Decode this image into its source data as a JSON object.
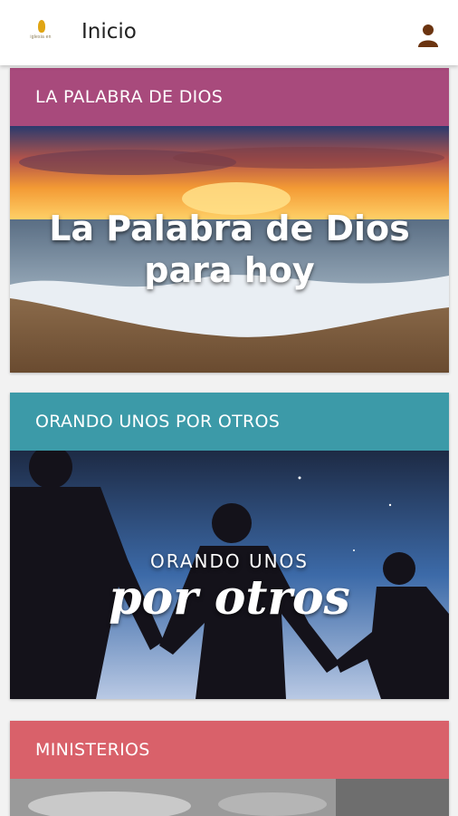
{
  "appbar": {
    "logo_icon": "church-logo",
    "logo_text": "iglesia en",
    "title": "Inicio",
    "profile_icon": "user-profile-icon"
  },
  "cards": [
    {
      "header": "LA PALABRA DE DIOS",
      "header_color": "#a84a7c",
      "image_title_line1": "La Palabra de Dios",
      "image_title_line2": "para hoy"
    },
    {
      "header": "ORANDO UNOS POR OTROS",
      "header_color": "#3c9aa8",
      "image_title_line1": "ORANDO UNOS",
      "image_title_line2": "por otros"
    },
    {
      "header": "MINISTERIOS",
      "header_color": "#d9616a"
    }
  ]
}
